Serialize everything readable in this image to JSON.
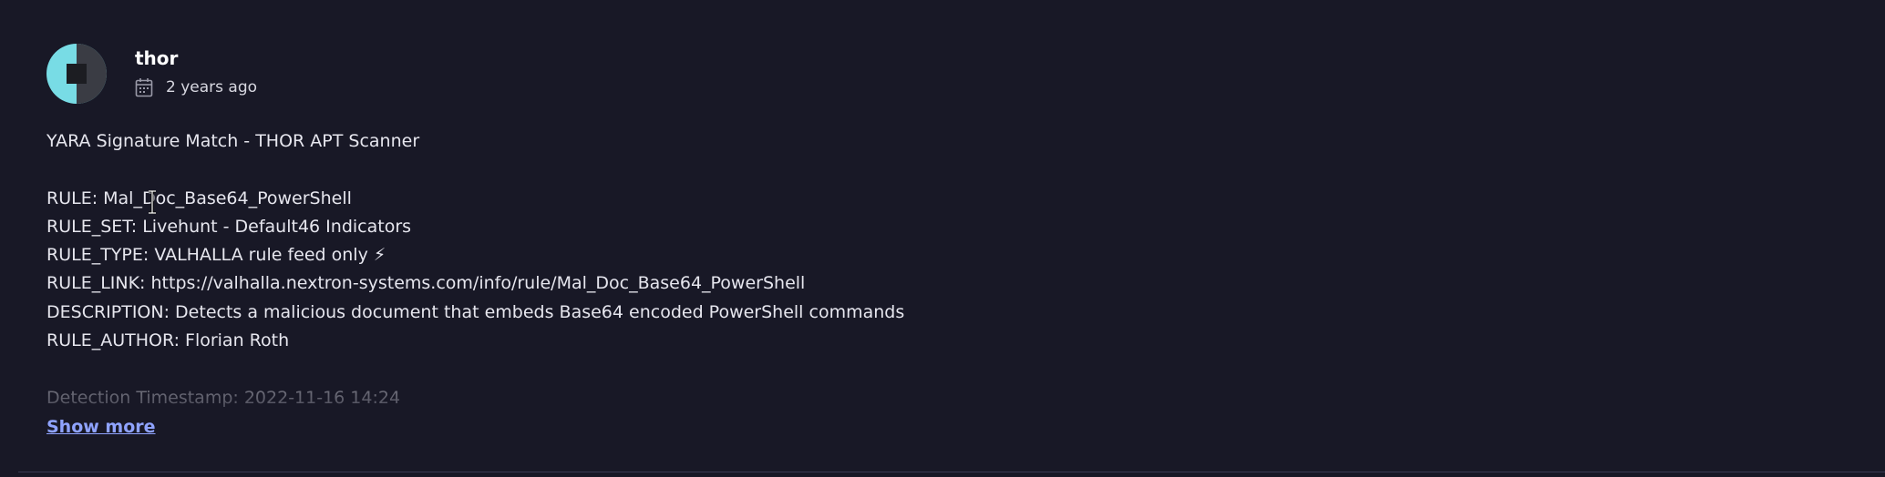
{
  "comment": {
    "author": "thor",
    "posted": "2 years ago",
    "lines": [
      "YARA Signature Match - THOR APT Scanner",
      "",
      "RULE: Mal_Doc_Base64_PowerShell",
      "RULE_SET: Livehunt - Default46 Indicators",
      "RULE_TYPE: VALHALLA rule feed only ⚡",
      "RULE_LINK: https://valhalla.nextron-systems.com/info/rule/Mal_Doc_Base64_PowerShell",
      "DESCRIPTION: Detects a malicious document that embeds Base64 encoded PowerShell commands",
      "RULE_AUTHOR: Florian Roth",
      "",
      "Detection Timestamp: 2022-11-16 14:24"
    ],
    "show_more_label": "Show more"
  },
  "icons": {
    "avatar": "avatar",
    "date": "calendar-icon"
  },
  "colors": {
    "background": "#181826",
    "link": "#8fa3ff",
    "avatar_primary": "#78dce5"
  }
}
